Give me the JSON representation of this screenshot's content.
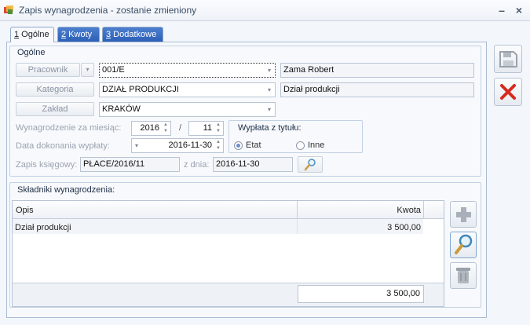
{
  "window": {
    "title": "Zapis wynagrodzenia - zostanie zmieniony",
    "minimize": "–",
    "close": "×"
  },
  "tabs": [
    {
      "num": "1",
      "label": " Ogólne"
    },
    {
      "num": "2",
      "label": " Kwoty"
    },
    {
      "num": "3",
      "label": " Dodatkowe"
    }
  ],
  "general": {
    "title": "Ogólne",
    "pracownik_btn": "Pracownik",
    "pracownik_code": "001/E",
    "pracownik_name": "Zama Robert",
    "kategoria_btn": "Kategoria",
    "kategoria_value": "DZIAŁ PRODUKCJI",
    "kategoria_desc": "Dział produkcji",
    "zaklad_btn": "Zakład",
    "zaklad_value": "KRAKÓW",
    "wynagrodzenie_label": "Wynagrodzenie za miesiąc:",
    "year": "2016",
    "slash": "/",
    "month": "11",
    "data_label": "Data dokonania wypłaty:",
    "data_value": "2016-11-30",
    "wyplata_title": "Wypłata z tytułu:",
    "etat_label": "Etat",
    "inne_label": "Inne",
    "zapis_label": "Zapis księgowy:",
    "zapis_value": "PŁACE/2016/11",
    "zdnia_label": "z dnia:",
    "zdnia_value": "2016-11-30"
  },
  "components": {
    "title": "Składniki wynagrodzenia:",
    "col_opis": "Opis",
    "col_kwota": "Kwota",
    "rows": [
      {
        "opis": "Dział produkcji",
        "kwota": "3 500,00"
      }
    ],
    "total": "3 500,00"
  }
}
